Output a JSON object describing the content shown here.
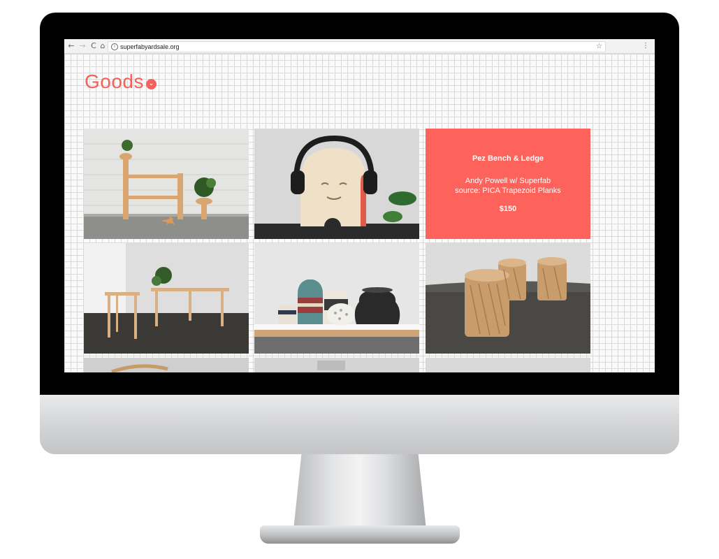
{
  "browser": {
    "url": "superfabyardsale.org",
    "back_icon": "←",
    "forward_icon": "→",
    "reload_icon": "C",
    "home_icon": "⌂",
    "info_icon": "i",
    "star_icon": "☆",
    "menu_icon": "⋮"
  },
  "page": {
    "title": "Goods",
    "title_chevron": "⌄",
    "accent_color": "#fd625b"
  },
  "products": {
    "featured": {
      "name": "Pez Bench & Ledge",
      "credit_line1": "Andy Powell w/ Superfab",
      "credit_line2": "source: PICA Trapezoid Planks",
      "price": "$150"
    }
  }
}
